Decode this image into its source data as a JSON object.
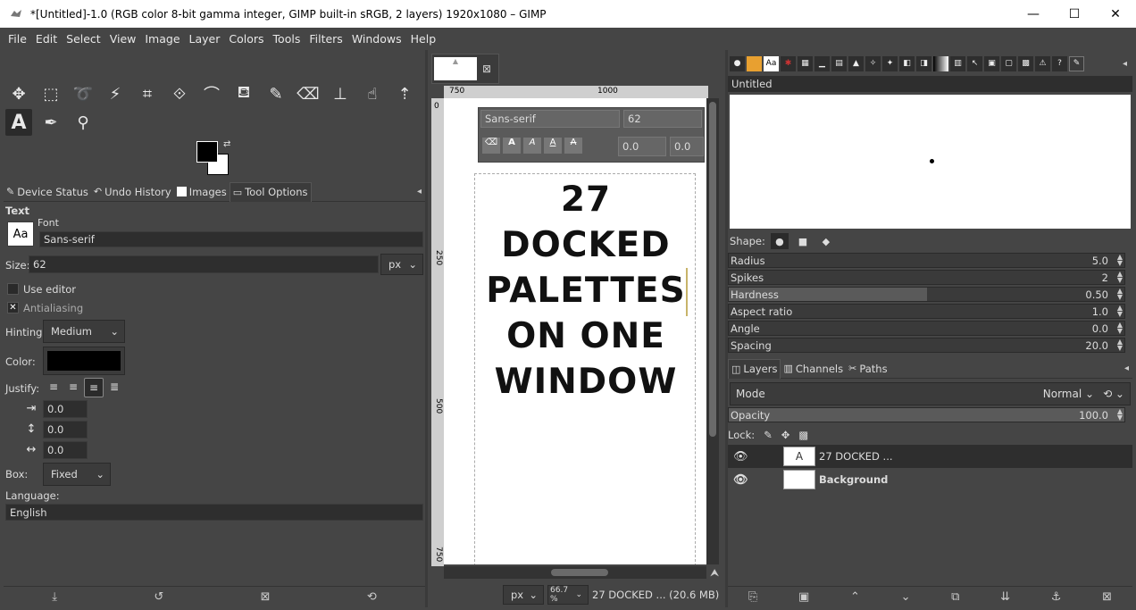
{
  "window": {
    "title": "*[Untitled]-1.0 (RGB color 8-bit gamma integer, GIMP built-in sRGB, 2 layers) 1920x1080 – GIMP",
    "minimize": "—",
    "maximize": "☐",
    "close": "✕"
  },
  "menu": [
    "File",
    "Edit",
    "Select",
    "View",
    "Image",
    "Layer",
    "Colors",
    "Tools",
    "Filters",
    "Windows",
    "Help"
  ],
  "left_tabs": {
    "device_status": "Device Status",
    "undo_history": "Undo History",
    "images": "Images",
    "tool_options": "Tool Options"
  },
  "tool_options": {
    "heading": "Text",
    "font_label": "Font",
    "font_preview": "Aa",
    "font_value": "Sans-serif",
    "size_label": "Size:",
    "size_value": "62",
    "size_unit": "px",
    "use_editor": "Use editor",
    "antialiasing": "Antialiasing",
    "hinting_label": "Hinting:",
    "hinting_value": "Medium",
    "color_label": "Color:",
    "text_color": "#000000",
    "justify_label": "Justify:",
    "indent_value": "0.0",
    "line_spacing_value": "0.0",
    "letter_spacing_value": "0.0",
    "box_label": "Box:",
    "box_value": "Fixed",
    "language_label": "Language:",
    "language_value": "English"
  },
  "canvas": {
    "ruler_h_1": "750",
    "ruler_h_2": "1000",
    "ruler_v_1": "0",
    "ruler_v_2": "250",
    "ruler_v_3": "500",
    "ruler_v_4": "750",
    "text_toolbar_font": "Sans-serif",
    "text_toolbar_size": "62",
    "text_toolbar_baseline": "0.0",
    "text_toolbar_kerning": "0.0",
    "text_lines": [
      "27",
      "DOCKED",
      "PALETTES",
      "ON ONE",
      "WINDOW"
    ],
    "status_unit": "px",
    "status_zoom": "66.7 %",
    "status_info": "27 DOCKED ... (20.6 MB)"
  },
  "brushes": {
    "name": "Untitled",
    "shape_label": "Shape:",
    "radius_label": "Radius",
    "radius_value": "5.0",
    "spikes_label": "Spikes",
    "spikes_value": "2",
    "hardness_label": "Hardness",
    "hardness_value": "0.50",
    "hardness_fraction": 0.5,
    "aspect_label": "Aspect ratio",
    "aspect_value": "1.0",
    "angle_label": "Angle",
    "angle_value": "0.0",
    "spacing_label": "Spacing",
    "spacing_value": "20.0"
  },
  "layers": {
    "tab_layers": "Layers",
    "tab_channels": "Channels",
    "tab_paths": "Paths",
    "mode_label": "Mode",
    "mode_value": "Normal",
    "opacity_label": "Opacity",
    "opacity_value": "100.0",
    "lock_label": "Lock:",
    "items": [
      {
        "name": "27 DOCKED ..."
      },
      {
        "name": "Background"
      }
    ]
  }
}
